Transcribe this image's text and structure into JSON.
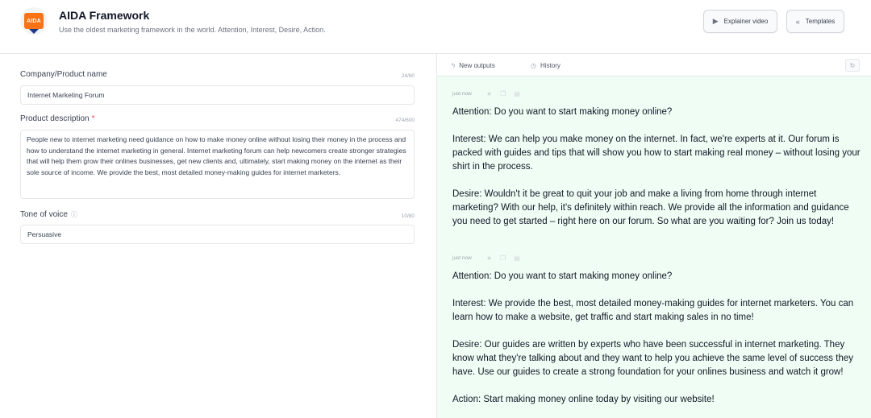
{
  "header": {
    "logo_text": "AIDA",
    "title": "AIDA Framework",
    "subtitle": "Use the oldest marketing framework in the world. Attention, Interest, Desire, Action.",
    "buttons": {
      "explainer_label": "Explainer video",
      "explainer_icon": "play-icon",
      "templates_label": "Templates",
      "templates_icon": "double-chevron-left-icon"
    }
  },
  "form": {
    "company": {
      "label": "Company/Product name",
      "count": "24/80",
      "value": "Internet Marketing Forum"
    },
    "description": {
      "label": "Product description",
      "required_mark": "*",
      "count": "474/600",
      "value": "People new to internet marketing need guidance on how to make money online without losing their money in the process and how to understand the internet marketing in general. Internet marketing forum can help newcomers create stronger strategies that will help them grow their onlines businesses, get new clients and, ultimately, start making money on the internet as their sole source of income. We provide the best, most detailed money-making guides for internet marketers."
    },
    "tone": {
      "label": "Tone of voice",
      "info_icon": "info-icon",
      "count": "10/80",
      "value": "Persuasive"
    }
  },
  "outputs_panel": {
    "tabs": [
      {
        "label": "New outputs",
        "icon": "bolt-icon"
      },
      {
        "label": "History",
        "icon": "clock-icon"
      }
    ],
    "refresh_icon": "refresh-icon",
    "outputs": [
      {
        "time": "just now",
        "paragraphs": [
          "Attention: Do you want to start making money online?",
          "Interest: We can help you make money on the internet. In fact, we're experts at it. Our forum is packed with guides and tips that will show you how to start making real money – without losing your shirt in the process.",
          "Desire: Wouldn't it be great to quit your job and make a living from home through internet marketing? With our help, it's definitely within reach. We provide all the information and guidance you need to get started – right here on our forum. So what are you waiting for? Join us today!"
        ]
      },
      {
        "time": "just now",
        "paragraphs": [
          "Attention: Do you want to start making money online?",
          "Interest: We provide the best, most detailed money-making guides for internet marketers. You can learn how to make a website, get traffic and start making sales in no time!",
          "Desire: Our guides are written by experts who have been successful in internet marketing. They know what they're talking about and they want to help you achieve the same level of success they have. Use our guides to create a strong foundation for your onlines business and watch it grow!",
          "Action: Start making money online today by visiting our website!"
        ]
      }
    ]
  }
}
